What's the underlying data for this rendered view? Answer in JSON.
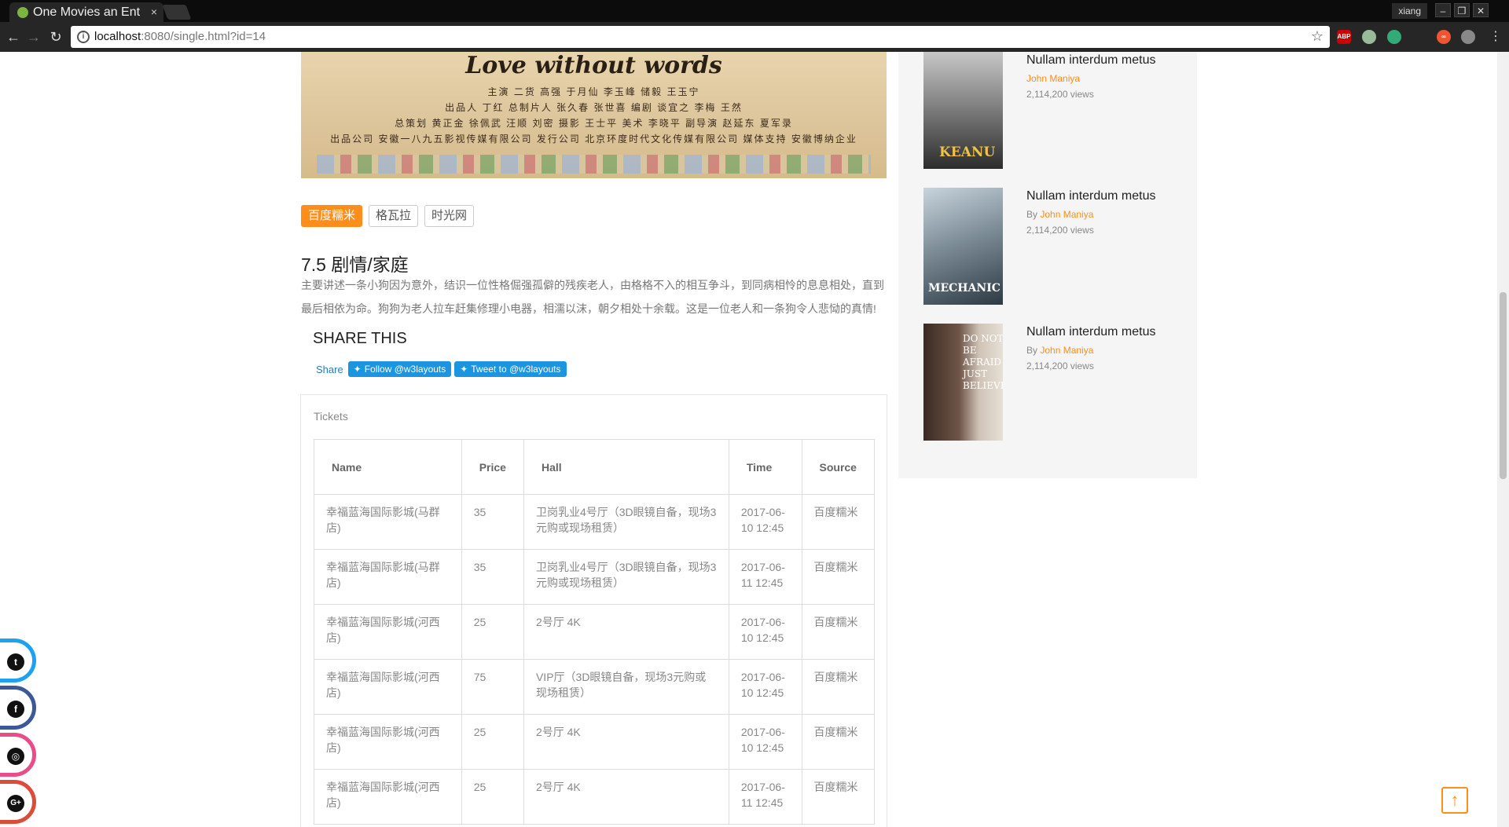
{
  "browser": {
    "tab_title": "One Movies an Ent",
    "tab_close": "×",
    "user_label": "xiang",
    "url_host": "localhost",
    "url_rest": ":8080/single.html?id=14",
    "win_minimize": "–",
    "win_restore": "❐",
    "win_close": "✕",
    "ext_abp": "ABP"
  },
  "poster": {
    "title": "Love without words",
    "credit_1": "主演  二货   高强   于月仙   李玉峰   储毅   王玉宁",
    "credit_2": "出品人 丁红   总制片人 张久春  张世喜   编剧 谈宜之   李梅   王然",
    "credit_3": "总策划 黄正金  徐佩武  汪顺  刘密   摄影 王士平   美术 李晓平   副导演 赵延东   夏军录",
    "credit_4": "出品公司 安徽一八九五影视传媒有限公司    发行公司 北京环度时代文化传媒有限公司    媒体支持 安徽博纳企业"
  },
  "sources": {
    "items": [
      "百度糯米",
      "格瓦拉",
      "时光网"
    ],
    "active_index": 0
  },
  "movie": {
    "rating_genre": "7.5 剧情/家庭",
    "description": "主要讲述一条小狗因为意外，结识一位性格倔强孤僻的残疾老人，由格格不入的相互争斗，到同病相怜的息息相处，直到最后相依为命。狗狗为老人拉车赶集修理小电器，相濡以沫，朝夕相处十余载。这是一位老人和一条狗令人悲恸的真情!"
  },
  "share": {
    "heading": "SHARE THIS",
    "share_link": "Share",
    "follow_label": "Follow @w3layouts",
    "tweet_label": "Tweet to @w3layouts"
  },
  "tickets": {
    "label": "Tickets",
    "columns": [
      "Name",
      "Price",
      "Hall",
      "Time",
      "Source"
    ],
    "rows": [
      [
        "幸福蓝海国际影城(马群店)",
        "35",
        "卫岗乳业4号厅（3D眼镜自备，现场3元购或现场租赁）",
        "2017-06-10 12:45",
        "百度糯米"
      ],
      [
        "幸福蓝海国际影城(马群店)",
        "35",
        "卫岗乳业4号厅（3D眼镜自备，现场3元购或现场租赁）",
        "2017-06-11 12:45",
        "百度糯米"
      ],
      [
        "幸福蓝海国际影城(河西店)",
        "25",
        "2号厅 4K",
        "2017-06-10 12:45",
        "百度糯米"
      ],
      [
        "幸福蓝海国际影城(河西店)",
        "75",
        "VIP厅（3D眼镜自备，现场3元购或现场租赁）",
        "2017-06-10 12:45",
        "百度糯米"
      ],
      [
        "幸福蓝海国际影城(河西店)",
        "25",
        "2号厅 4K",
        "2017-06-10 12:45",
        "百度糯米"
      ],
      [
        "幸福蓝海国际影城(河西店)",
        "25",
        "2号厅 4K",
        "2017-06-11 12:45",
        "百度糯米"
      ]
    ]
  },
  "sidebar": {
    "items": [
      {
        "title": "Nullam interdum metus",
        "by_prefix": "",
        "author": "John Maniya",
        "views": "2,114,200 views",
        "thumb_text": "KEANU"
      },
      {
        "title": "Nullam interdum metus",
        "by_prefix": "By ",
        "author": "John Maniya",
        "views": "2,114,200 views",
        "thumb_text": "MECHANIC"
      },
      {
        "title": "Nullam interdum metus",
        "by_prefix": "By ",
        "author": "John Maniya",
        "views": "2,114,200 views",
        "thumb_text": "DO NOT BE AFRAID JUST BELIEVE"
      }
    ]
  },
  "social": {
    "twitter_color": "#1da1f2",
    "facebook_color": "#3b5998",
    "dribbble_color": "#ea4c89",
    "google_color": "#dd4b39"
  },
  "colors": {
    "accent": "#ff8d1b",
    "twitter_button": "#1b95e0"
  }
}
